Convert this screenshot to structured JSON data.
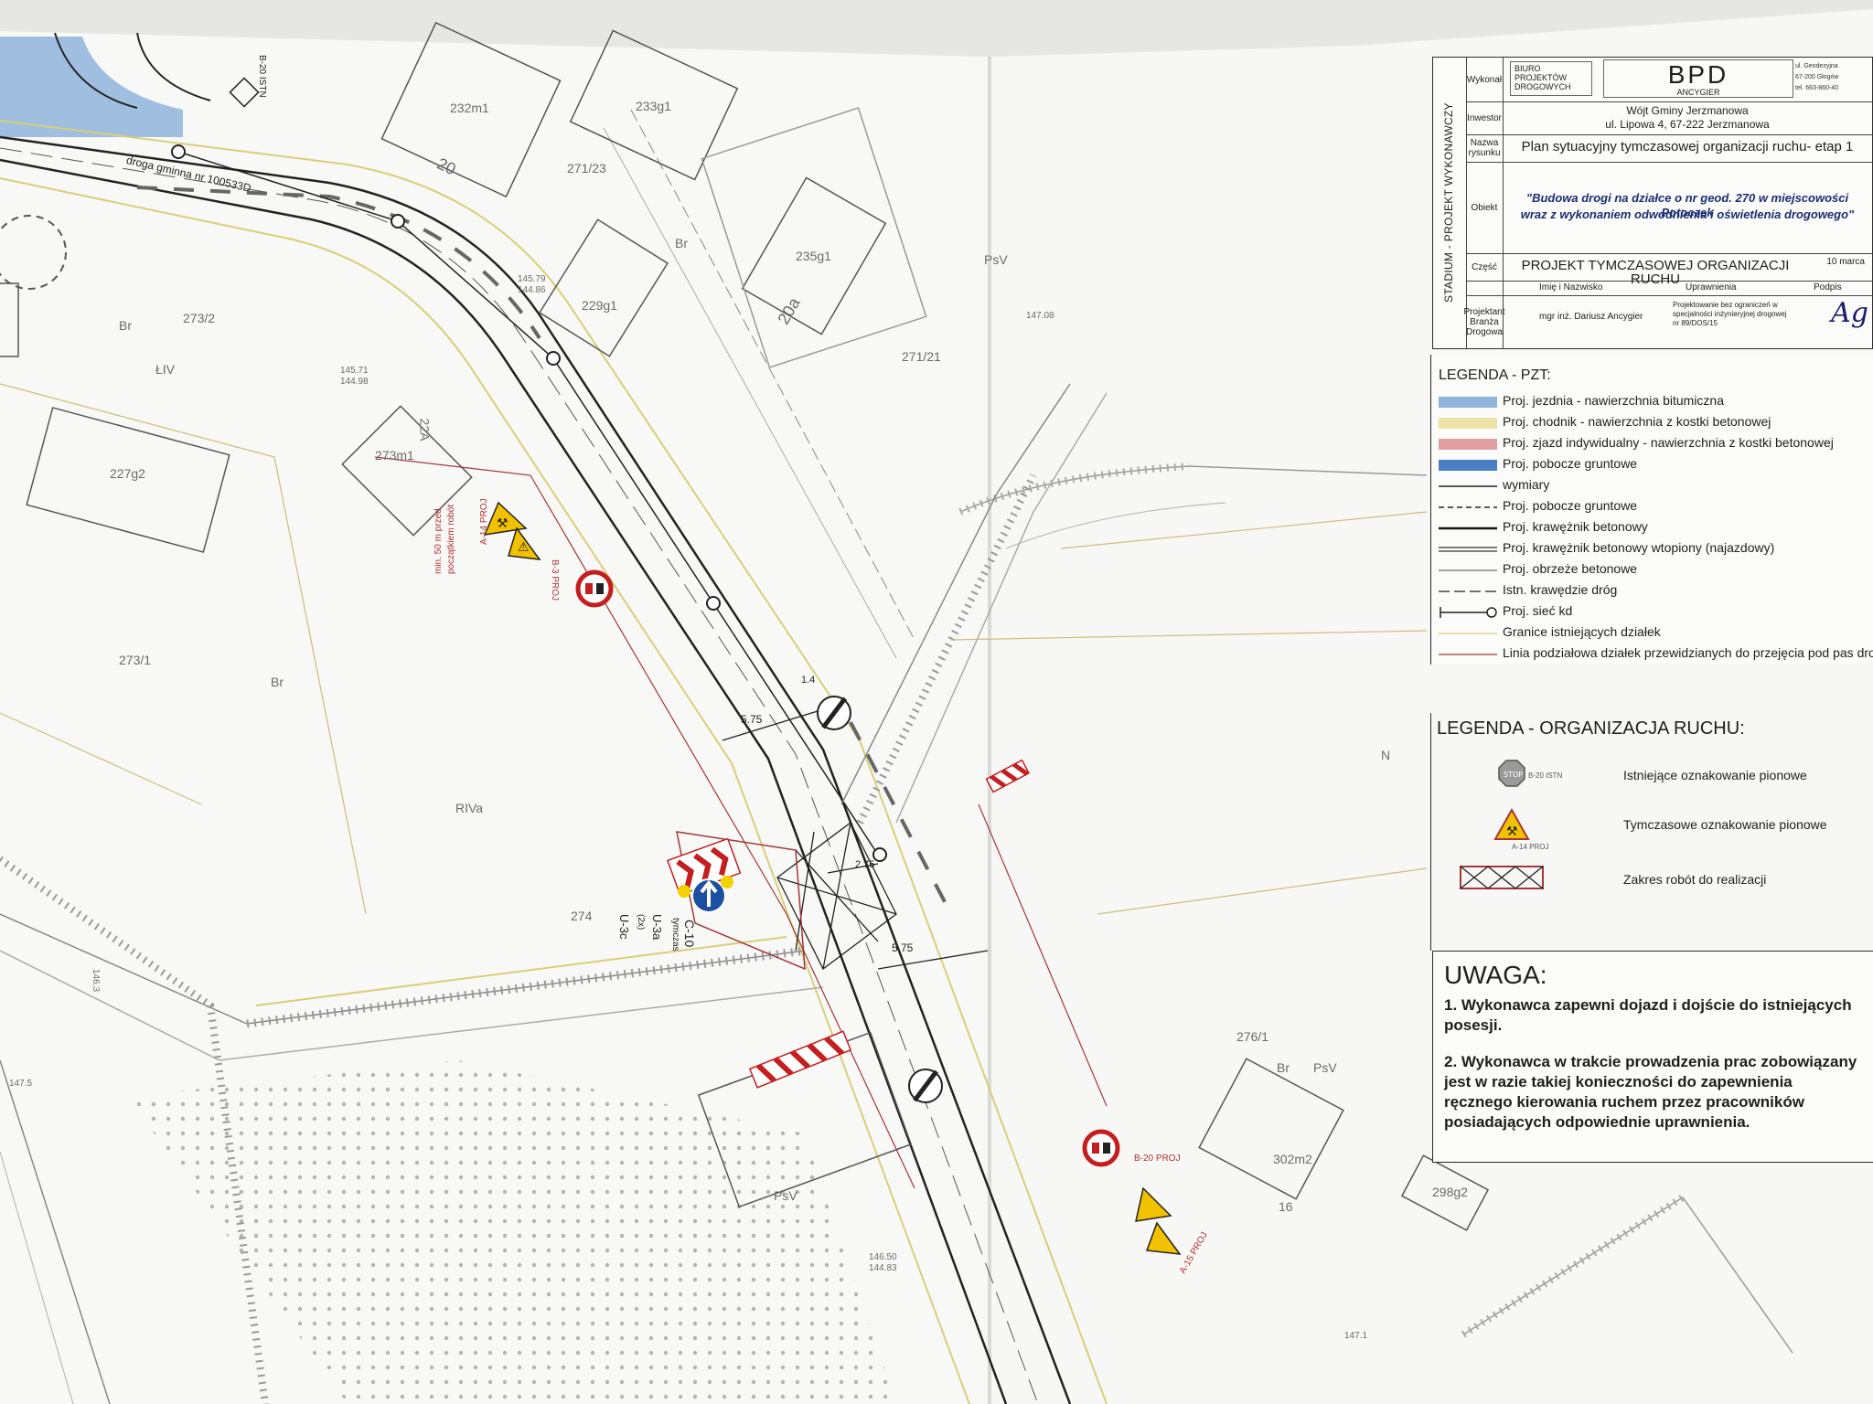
{
  "sheet": {
    "title_block": {
      "stage_label": "STADIUM - PROJEKT WYKONAWCZY",
      "wykonal_key": "Wykonał",
      "company_lines": [
        "BIURO",
        "PROJEKTÓW",
        "DROGOWYCH"
      ],
      "logo_text": "BPD",
      "logo_sub": "ANCYGIER",
      "address_lines": [
        "ul. Geodezyjna",
        "67-200 Głogów",
        "tel. 663-860-40"
      ],
      "investor_key": "Inwestor",
      "investor_lines": [
        "Wójt Gminy Jerzmanowa",
        "ul. Lipowa 4, 67-222 Jerzmanowa"
      ],
      "drawing_name_key": "Nazwa rysunku",
      "drawing_name": "Plan sytuacyjny tymczasowej organizacji ruchu- etap 1",
      "object_key": "Obiekt",
      "object_lines": [
        "\"Budowa drogi na działce o nr geod. 270 w miejscowości Potoczek",
        "wraz z wykonaniem odwodnienia i oświetlenia drogowego\""
      ],
      "part_key": "Część",
      "part_name": "PROJEKT TYMCZASOWEJ ORGANIZACJI RUCHU",
      "date": "10 marca",
      "col_name": "Imię i Nazwisko",
      "col_rights": "Uprawnienia",
      "col_sign": "Podpis",
      "designer_role": "Projektant Branża Drogowa",
      "designer_name": "mgr inż. Dariusz Ancygier",
      "designer_rights": "Projektowanie bez ograniczeń w specjalności inżynieryjnej drogowej nr 89/DOS/15",
      "signature": "Ag"
    },
    "legend_pzt": {
      "title": "LEGENDA - PZT:",
      "items": [
        {
          "label": "Proj. jezdnia - nawierzchnia bitumiczna",
          "color": "#8fb4dc",
          "kind": "fill"
        },
        {
          "label": "Proj. chodnik - nawierzchnia z kostki betonowej",
          "color": "#ede3a8",
          "kind": "fill"
        },
        {
          "label": "Proj. zjazd indywidualny - nawierzchnia z kostki betonowej",
          "color": "#e0a0a0",
          "kind": "fill"
        },
        {
          "label": "Proj. pobocze gruntowe",
          "color": "#4b7fc4",
          "kind": "fill"
        },
        {
          "label": "wymiary",
          "color": "#222222",
          "kind": "solid"
        },
        {
          "label": "Proj. pobocze gruntowe",
          "color": "#222222",
          "kind": "dashed"
        },
        {
          "label": "Proj. krawężnik betonowy",
          "color": "#111111",
          "kind": "thick"
        },
        {
          "label": "Proj. krawężnik betonowy wtopiony (najazdowy)",
          "color": "#333333",
          "kind": "double"
        },
        {
          "label": "Proj. obrzeże betonowe",
          "color": "#666666",
          "kind": "thin"
        },
        {
          "label": "Istn. krawędzie dróg",
          "color": "#444444",
          "kind": "longdash"
        },
        {
          "label": "Proj. sieć kd",
          "color": "#222222",
          "kind": "pipe"
        },
        {
          "label": "Granice istniejących działek",
          "color": "#d8cf7a",
          "kind": "thin"
        },
        {
          "label": "Linia podziałowa działek przewidzianych do przejęcia pod pas drogowy",
          "color": "#a03838",
          "kind": "thin"
        }
      ]
    },
    "legend_traffic": {
      "title": "LEGENDA - ORGANIZACJA RUCHU:",
      "items": [
        {
          "label": "Istniejące oznakowanie pionowe",
          "symbol": "stop-sign",
          "caption": "B-20 ISTN"
        },
        {
          "label": "Tymczasowe oznakowanie pionowe",
          "symbol": "warning-sign",
          "caption": "A-14 PROJ"
        },
        {
          "label": "Zakres robót do realizacji",
          "symbol": "work-zone",
          "caption": ""
        }
      ]
    },
    "notes": {
      "title": "UWAGA:",
      "items": [
        "1. Wykonawca zapewni dojazd i dojście do istniejących posesji.",
        "2. Wykonawca w trakcie prowadzenia prac zobowiązany jest w razie takiej konieczności do zapewnienia ręcznego kierowania ruchem przez pracowników posiadających odpowiednie uprawnienia."
      ]
    },
    "map_labels": {
      "parcel_232": "232m1",
      "parcel_233": "233g1",
      "parcel_20": "20",
      "parcel_271_23": "271/23",
      "parcel_235": "235g1",
      "parcel_20a": "20a",
      "parcel_229": "229g1",
      "parcel_273_2": "273/2",
      "parcel_LIV": "ŁIV",
      "parcel_227": "227g2",
      "parcel_22A": "22A",
      "parcel_273m1": "273m1",
      "parcel_271_21": "271/21",
      "parcel_273_1": "273/1",
      "parcel_RIVa": "RIVa",
      "parcel_274": "274",
      "parcel_276_1": "276/1",
      "parcel_302": "302m2",
      "parcel_16": "16",
      "parcel_298": "298g2",
      "parcel_PsV_1": "PsV",
      "parcel_PsV_2": "PsV",
      "parcel_PsV_3": "PsV",
      "parcel_Br_1": "Br",
      "parcel_Br_2": "Br",
      "parcel_Br_3": "Br",
      "parcel_Br_4": "Br",
      "parcel_N": "N",
      "road_name": "droga gminna nr 100533D",
      "dim_575_a": "5.75",
      "dim_575_b": "5.75",
      "dim_14": "1.4",
      "dim_275": "2.75",
      "sign_c10": "C-10",
      "sign_c10_sub": "tymczas",
      "sign_u3a": "U-3a",
      "sign_u3a_sub": "(2x)",
      "sign_u3c": "U-3c",
      "sign_a14_proj": "A-14 PROJ",
      "sign_a15_proj": "A-15 PROJ",
      "sign_b20_proj": "B-20 PROJ",
      "sign_b3_proj": "B-3 PROJ",
      "elev_1": "145.79",
      "elev_2": "144.86",
      "elev_3": "147.08",
      "elev_4": "145.71",
      "elev_5": "144.98",
      "elev_6": "146.50",
      "elev_7": "144.83",
      "elev_8": "147.5",
      "elev_9": "147.1",
      "elev_10": "146.3",
      "sign_stop_istn": "B-20 ISTN",
      "dist_1": "min. 50 m przed",
      "dist_2": "początkiem robót"
    },
    "colors": {
      "paper": "#f7f7f5",
      "road_fill": "#8fb4dc",
      "sidewalk_fill": "#ede3a8",
      "driveway_fill": "#e0a0a0",
      "red_line": "#a03838",
      "sign_yellow": "#f2c200",
      "sign_red": "#c41e1e"
    }
  }
}
